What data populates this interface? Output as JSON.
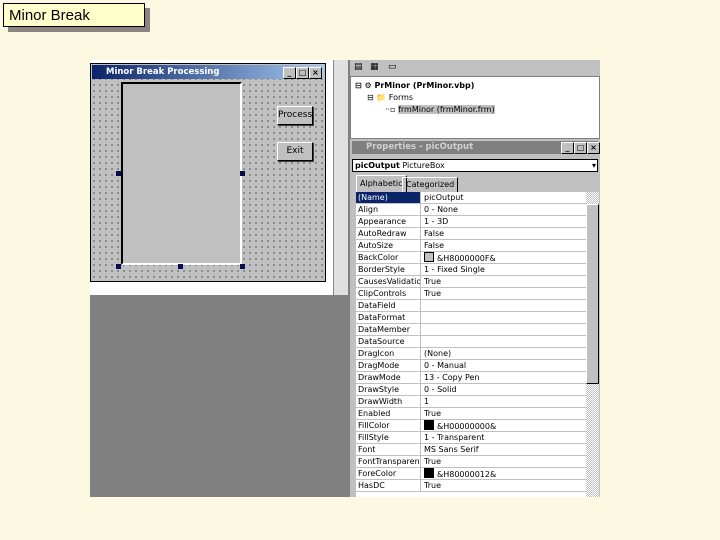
{
  "slide": {
    "title": "Minor Break"
  },
  "form": {
    "title": "Minor Break Processing",
    "buttons": [
      "Process",
      "Exit"
    ]
  },
  "project": {
    "root": "PrMinor (PrMinor.vbp)",
    "folder": "Forms",
    "item": "frmMinor (frmMinor.frm)"
  },
  "properties": {
    "title": "Properties - picOutput",
    "object_name": "picOutput",
    "object_type": "PictureBox",
    "tabs": [
      "Alphabetic",
      "Categorized"
    ],
    "rows": [
      {
        "name": "(Name)",
        "value": "picOutput"
      },
      {
        "name": "Align",
        "value": "0 - None"
      },
      {
        "name": "Appearance",
        "value": "1 - 3D"
      },
      {
        "name": "AutoRedraw",
        "value": "False"
      },
      {
        "name": "AutoSize",
        "value": "False"
      },
      {
        "name": "BackColor",
        "value": "&H8000000F&",
        "swatch": "#c0c0c0"
      },
      {
        "name": "BorderStyle",
        "value": "1 - Fixed Single"
      },
      {
        "name": "CausesValidation",
        "value": "True"
      },
      {
        "name": "ClipControls",
        "value": "True"
      },
      {
        "name": "DataField",
        "value": ""
      },
      {
        "name": "DataFormat",
        "value": ""
      },
      {
        "name": "DataMember",
        "value": ""
      },
      {
        "name": "DataSource",
        "value": ""
      },
      {
        "name": "DragIcon",
        "value": "(None)"
      },
      {
        "name": "DragMode",
        "value": "0 - Manual"
      },
      {
        "name": "DrawMode",
        "value": "13 - Copy Pen"
      },
      {
        "name": "DrawStyle",
        "value": "0 - Solid"
      },
      {
        "name": "DrawWidth",
        "value": "1"
      },
      {
        "name": "Enabled",
        "value": "True"
      },
      {
        "name": "FillColor",
        "value": "&H00000000&",
        "swatch": "#000000"
      },
      {
        "name": "FillStyle",
        "value": "1 - Transparent"
      },
      {
        "name": "Font",
        "value": "MS Sans Serif"
      },
      {
        "name": "FontTransparent",
        "value": "True"
      },
      {
        "name": "ForeColor",
        "value": "&H80000012&",
        "swatch": "#000000"
      },
      {
        "name": "HasDC",
        "value": "True"
      }
    ]
  },
  "colors": {
    "selection": "#0a246a",
    "background": "#fdf8e2"
  }
}
